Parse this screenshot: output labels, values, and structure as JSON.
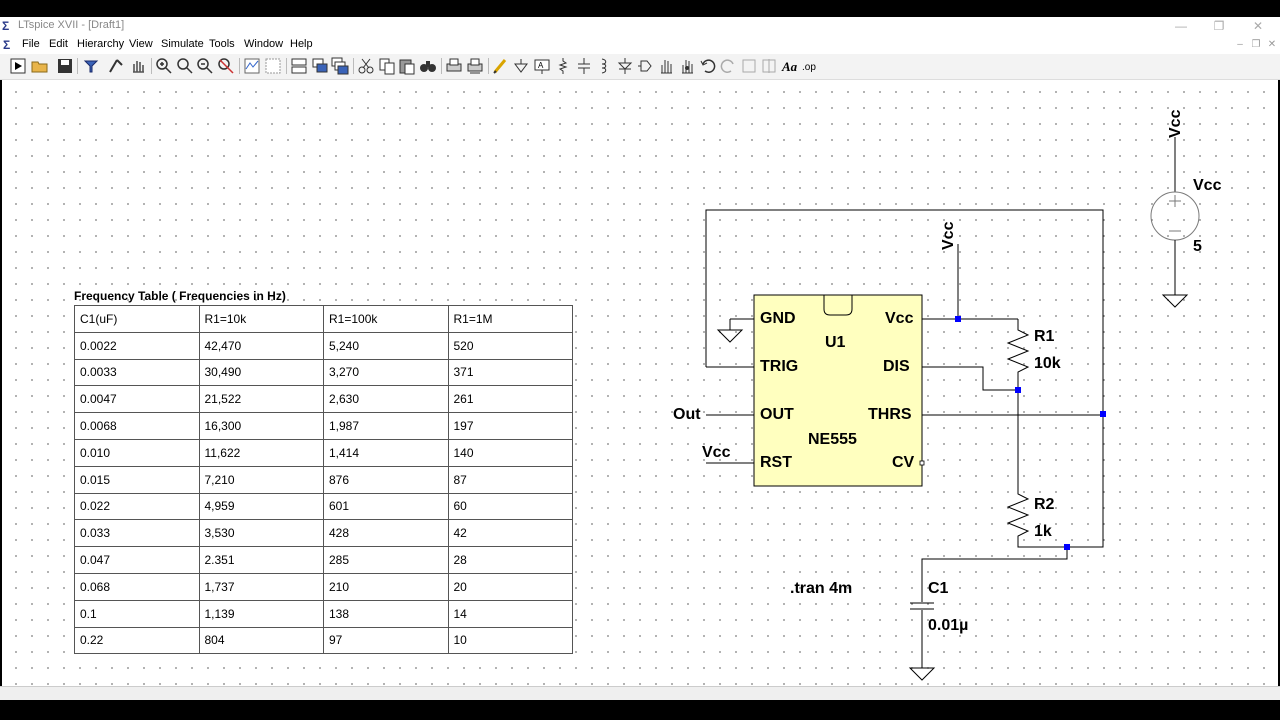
{
  "window": {
    "title": "LTspice XVII - [Draft1]",
    "minimize_icon": "minimize-icon",
    "restore_icon": "restore-icon",
    "close_icon": "close-icon"
  },
  "menu": {
    "items": [
      "File",
      "Edit",
      "Hierarchy",
      "View",
      "Simulate",
      "Tools",
      "Window",
      "Help"
    ]
  },
  "table": {
    "caption": "Frequency Table ( Frequencies in Hz)",
    "headers": [
      "C1(uF)",
      "R1=10k",
      "R1=100k",
      "R1=1M"
    ],
    "rows": [
      [
        "0.0022",
        "42,470",
        "5,240",
        "520"
      ],
      [
        "0.0033",
        "30,490",
        "3,270",
        "371"
      ],
      [
        "0.0047",
        "21,522",
        "2,630",
        "261"
      ],
      [
        "0.0068",
        "16,300",
        "1,987",
        "197"
      ],
      [
        "0.010",
        "11,622",
        "1,414",
        "140"
      ],
      [
        "0.015",
        "7,210",
        "876",
        "87"
      ],
      [
        "0.022",
        "4,959",
        "601",
        "60"
      ],
      [
        "0.033",
        "3,530",
        "428",
        "42"
      ],
      [
        "0.047",
        "2.351",
        "285",
        "28"
      ],
      [
        "0.068",
        "1,737",
        "210",
        "20"
      ],
      [
        "0.1",
        "1,139",
        "138",
        "14"
      ],
      [
        "0.22",
        "804",
        "97",
        "10"
      ]
    ]
  },
  "schematic": {
    "ic": {
      "name": "U1",
      "part": "NE555",
      "pins_left": [
        "GND",
        "TRIG",
        "OUT",
        "RST"
      ],
      "pins_right": [
        "Vcc",
        "DIS",
        "THRS",
        "CV"
      ]
    },
    "net_labels": {
      "vcc_top": "Vcc",
      "vcc_ic": "Vcc",
      "vcc_rst": "Vcc",
      "out": "Out"
    },
    "source": {
      "name": "Vcc",
      "value": "5"
    },
    "r1": {
      "name": "R1",
      "value": "10k"
    },
    "r2": {
      "name": "R2",
      "value": "1k"
    },
    "c1": {
      "name": "C1",
      "value": "0.01µ"
    },
    "directive": ".tran 4m",
    "colors": {
      "ic_fill": "#ffffbf",
      "wire": "#000000",
      "junction": "#0000ff",
      "source_outline": "#7a7a7a"
    }
  }
}
